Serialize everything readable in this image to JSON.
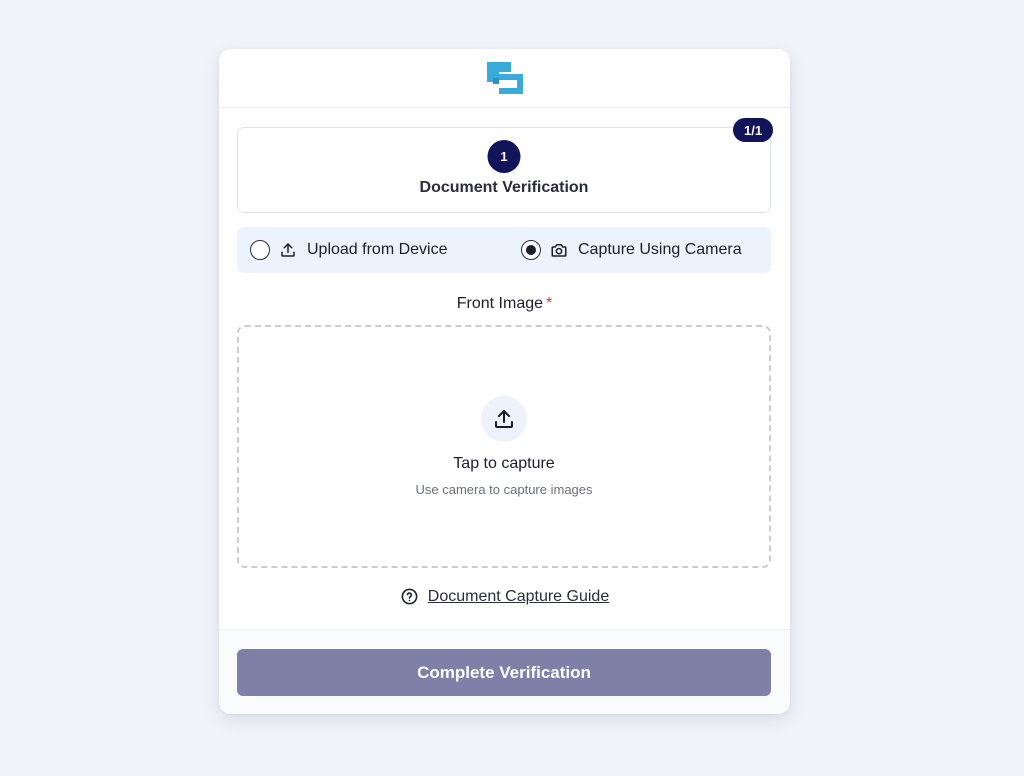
{
  "header": {
    "logo_icon": "brand-logo-icon",
    "brand_color": "#3aabd9"
  },
  "step": {
    "number": "1",
    "title": "Document Verification",
    "badge": "1/1",
    "accent_color": "#121459"
  },
  "methods": {
    "upload_label": "Upload from Device",
    "upload_icon": "upload-icon",
    "upload_selected": false,
    "camera_label": "Capture Using Camera",
    "camera_icon": "camera-icon",
    "camera_selected": true
  },
  "field": {
    "label": "Front Image",
    "required_mark": "*"
  },
  "dropzone": {
    "icon": "upload-icon",
    "title": "Tap to capture",
    "subtitle": "Use camera to capture images"
  },
  "guide": {
    "icon": "help-circle-icon",
    "link_label": "Document Capture Guide"
  },
  "footer": {
    "button_label": "Complete Verification",
    "button_color": "#7e80a7"
  }
}
